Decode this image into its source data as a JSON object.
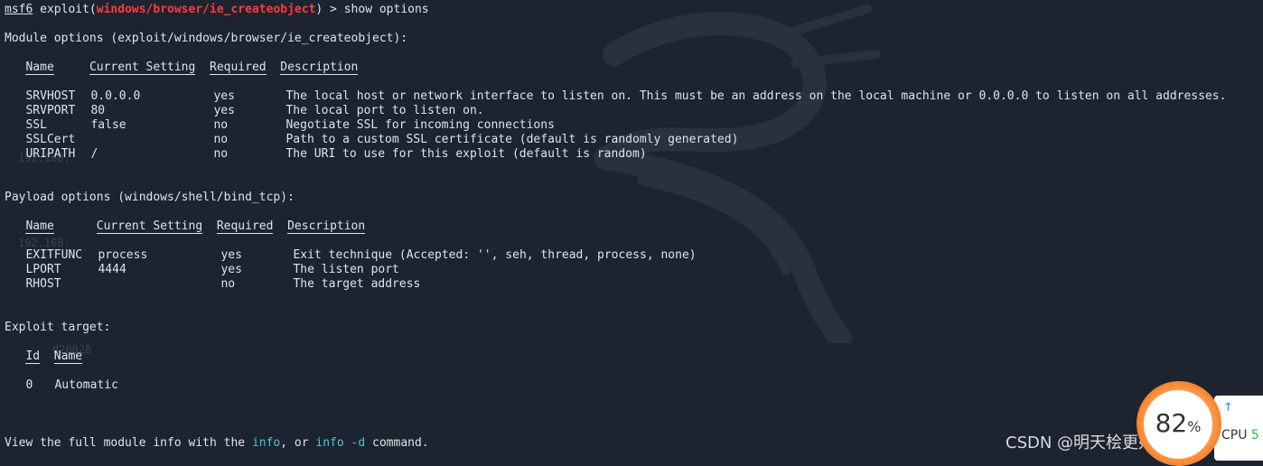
{
  "prompt": {
    "label": "msf6",
    "text_pre": " exploit(",
    "module": "windows/browser/ie_createobject",
    "text_post": ") > show options"
  },
  "module_options": {
    "heading": "Module options (exploit/windows/browser/ie_createobject):",
    "headers": {
      "name": "Name",
      "setting": "Current Setting",
      "required": "Required",
      "desc": "Description"
    },
    "rows": [
      {
        "name": "SRVHOST",
        "setting": "0.0.0.0",
        "required": "yes",
        "desc": "The local host or network interface to listen on. This must be an address on the local machine or 0.0.0.0 to listen on all addresses."
      },
      {
        "name": "SRVPORT",
        "setting": "80",
        "required": "yes",
        "desc": "The local port to listen on."
      },
      {
        "name": "SSL",
        "setting": "false",
        "required": "no",
        "desc": "Negotiate SSL for incoming connections"
      },
      {
        "name": "SSLCert",
        "setting": "",
        "required": "no",
        "desc": "Path to a custom SSL certificate (default is randomly generated)"
      },
      {
        "name": "URIPATH",
        "setting": "/",
        "required": "no",
        "desc": "The URI to use for this exploit (default is random)"
      }
    ]
  },
  "payload_options": {
    "heading": "Payload options (windows/shell/bind_tcp):",
    "headers": {
      "name": "Name",
      "setting": "Current Setting",
      "required": "Required",
      "desc": "Description"
    },
    "rows": [
      {
        "name": "EXITFUNC",
        "setting": "process",
        "required": "yes",
        "desc": "Exit technique (Accepted: '', seh, thread, process, none)"
      },
      {
        "name": "LPORT",
        "setting": "4444",
        "required": "yes",
        "desc": "The listen port"
      },
      {
        "name": "RHOST",
        "setting": "",
        "required": "no",
        "desc": "The target address"
      }
    ]
  },
  "exploit_target": {
    "heading": "Exploit target:",
    "headers": {
      "id": "Id",
      "name": "Name"
    },
    "rows": [
      {
        "id": "0",
        "name": "Automatic"
      }
    ]
  },
  "footer": {
    "pre": "View the full module info with the ",
    "info": "info",
    "mid": ", or ",
    "info_d": "info -d",
    "post": " command."
  },
  "ghosts": {
    "g1": "192.168.",
    "g2": "192.168.",
    "g3": "d20028"
  },
  "watermark": "CSDN @明天桧更好20222928",
  "widget": {
    "percent": "82",
    "percent_sign": "%",
    "arrow": "↑",
    "cpu_label": "CPU",
    "cpu_value": "5"
  },
  "colors": {
    "background": "#1e2330",
    "text": "#dfe3ea",
    "module_red": "#ff3b3b",
    "cyan": "#4fc3d9",
    "widget_orange": "#f07a22",
    "cpu_green": "#2db84d"
  }
}
